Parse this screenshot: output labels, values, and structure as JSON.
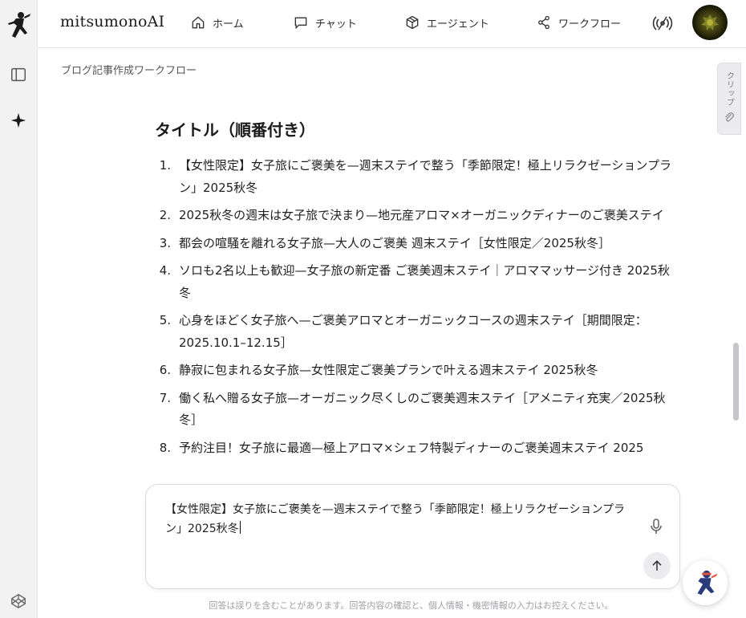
{
  "app": {
    "brand": "mitsumonoAI"
  },
  "nav": [
    {
      "label": "ホーム",
      "icon": "home-icon"
    },
    {
      "label": "チャット",
      "icon": "chat-icon"
    },
    {
      "label": "エージェント",
      "icon": "cube-icon"
    },
    {
      "label": "ワークフロー",
      "icon": "share-nodes-icon"
    }
  ],
  "breadcrumb": "ブログ記事作成ワークフロー",
  "content": {
    "heading": "タイトル（順番付き）",
    "titles": [
      {
        "num": "1.",
        "text": "【女性限定】女子旅にご褒美を—週末ステイで整う「季節限定！極上リラクゼーションプラン」2025秋冬"
      },
      {
        "num": "2.",
        "text": "2025秋冬の週末は女子旅で決まり—地元産アロマ×オーガニックディナーのご褒美ステイ"
      },
      {
        "num": "3.",
        "text": "都会の喧騒を離れる女子旅—大人のご褒美 週末ステイ［女性限定／2025秋冬］"
      },
      {
        "num": "4.",
        "text": "ソロも2名以上も歓迎—女子旅の新定番 ご褒美週末ステイ｜アロママッサージ付き 2025秋冬"
      },
      {
        "num": "5.",
        "text": "心身をほどく女子旅へ—ご褒美アロマとオーガニックコースの週末ステイ［期間限定：2025.10.1–12.15］"
      },
      {
        "num": "6.",
        "text": "静寂に包まれる女子旅—女性限定ご褒美プランで叶える週末ステイ 2025秋冬"
      },
      {
        "num": "7.",
        "text": "働く私へ贈る女子旅—オーガニック尽くしのご褒美週末ステイ［アメニティ充実／2025秋冬］"
      },
      {
        "num": "8.",
        "text": "予約注目！女子旅に最適—極上アロマ×シェフ特製ディナーのご褒美週末ステイ 2025"
      }
    ]
  },
  "clip": {
    "label": "クリップ"
  },
  "composer": {
    "value": "【女性限定】女子旅にご褒美を—週末ステイで整う「季節限定！極上リラクゼーションプラン」2025秋冬"
  },
  "disclaimer": "回答は誤りを含むことがあります。回答内容の確認と、個人情報・機密情報の入力はお控えください。",
  "colors": {
    "rail_bg": "#f2f2f3",
    "accent_dark": "#1a1a1a",
    "muted": "#a0a0a5"
  }
}
